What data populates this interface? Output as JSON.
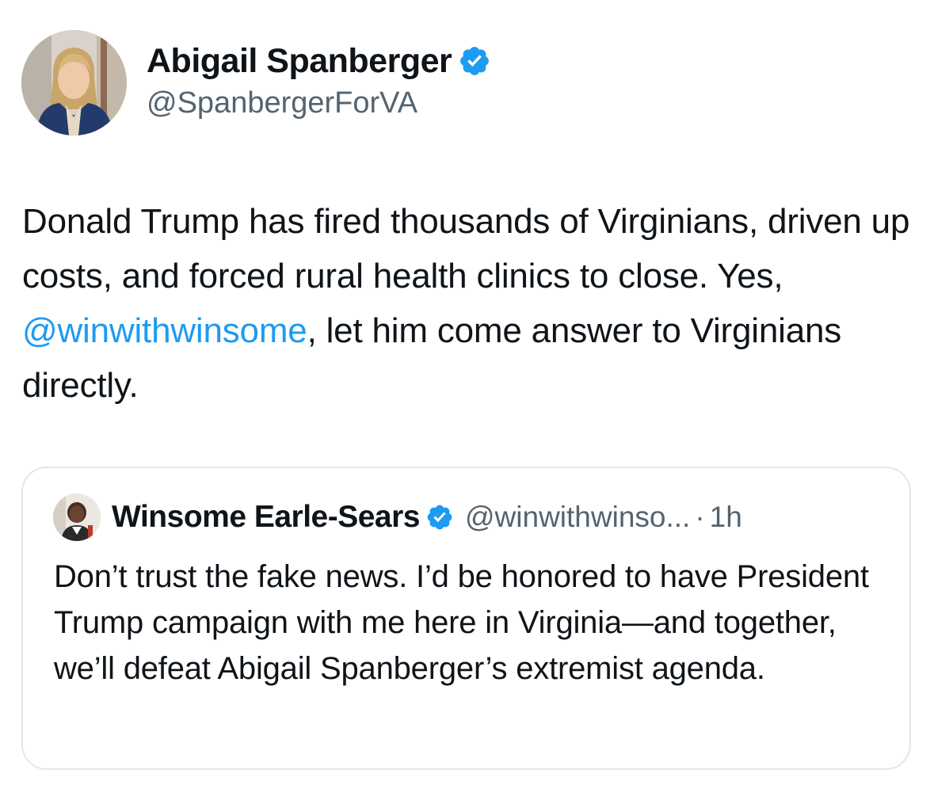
{
  "author": {
    "name": "Abigail Spanberger",
    "handle": "@SpanbergerForVA",
    "verified": true,
    "avatar_icon": "profile-photo"
  },
  "tweet": {
    "text_before_mention": "Donald Trump has fired thousands of Virginians, driven up costs, and forced rural health clinics to close. Yes, ",
    "mention": "@winwithwinsome",
    "text_after_mention": ", let him come answer to Virginians directly."
  },
  "quote": {
    "name": "Winsome Earle-Sears",
    "verified": true,
    "handle": "@winwithwinso...",
    "separator": "·",
    "time": "1h",
    "text": "Don’t trust the fake news. I’d be honored to have President Trump campaign with me here in Virginia—and together, we’ll defeat Abigail Spanberger’s extremist agenda.",
    "avatar_icon": "profile-photo"
  },
  "colors": {
    "text": "#0f1419",
    "secondary": "#536471",
    "link": "#1d9bf0",
    "verified_badge": "#1d9bf0",
    "card_border": "#e3e6e8"
  }
}
